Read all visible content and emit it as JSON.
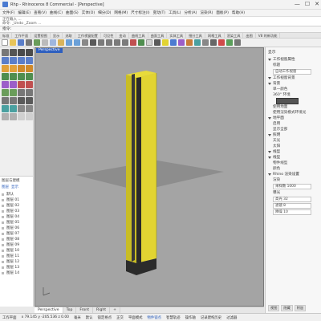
{
  "window": {
    "title": "Rhp - Rhinoceros 8 Commercial - [Perspective]",
    "controls": [
      "—",
      "☐",
      "✕"
    ]
  },
  "menu": [
    "文件(F)",
    "编辑(E)",
    "查看(V)",
    "曲线(C)",
    "曲面(S)",
    "实体(O)",
    "细分(D)",
    "网格(M)",
    "尺寸标注(I)",
    "变动(T)",
    "工具(L)",
    "分析(A)",
    "渲染(R)",
    "面板(P)",
    "帮助(H)"
  ],
  "command_history": [
    "正在载入 ...",
    "命令: _Undo  _Zoom ...",
    "指令: _Zoom All Extents"
  ],
  "command_prompt": "指令:",
  "toolbar_tabs": [
    "标准",
    "工作平面",
    "设置视图",
    "显示",
    "选取",
    "工作视窗配置",
    "可见性",
    "变动",
    "曲线工具",
    "曲面工具",
    "实体工具",
    "细分工具",
    "网格工具",
    "渲染工具",
    "出图",
    "V8 的新功能"
  ],
  "viewport": {
    "label": "Perspective"
  },
  "layers_panel": {
    "header": "图层与建模",
    "tabs": [
      "图层",
      "显示"
    ],
    "items": [
      "默认",
      "图层 01",
      "图层 02",
      "图层 03",
      "图层 04",
      "图层 05",
      "图层 06",
      "图层 07",
      "图层 08",
      "图层 09",
      "图层 10",
      "图层 11",
      "图层 12",
      "图层 13",
      "图层 14"
    ]
  },
  "view_tabs": [
    "Perspective",
    "Top",
    "Front",
    "Right",
    "+"
  ],
  "status": {
    "cplane": "工作平面",
    "coords": "x 79.145   y -205.536   z 0.00",
    "units": "毫米",
    "layer": "默认",
    "items": [
      "锁定格点",
      "正交",
      "平面模式",
      "物件锁点",
      "智慧轨迹",
      "操作轴",
      "记录建构历史",
      "过滤器"
    ]
  },
  "right_panel": {
    "title": "显示",
    "sections": [
      {
        "label": "工作视窗属性",
        "rows": [
          "标题",
          "自动工作视窗"
        ]
      },
      {
        "label": "工作视窗背景",
        "rows": []
      },
      {
        "label": "背景",
        "rows": [
          "单一颜色",
          "360° 环境",
          "使用地面",
          "使用渲染模式环境光"
        ]
      },
      {
        "label": "地平面",
        "rows": [
          "启用",
          "显示全部"
        ]
      },
      {
        "label": "照明",
        "rows": [
          "天光",
          "太阳"
        ]
      },
      {
        "label": "线型",
        "rows": []
      },
      {
        "label": "线型",
        "rows": [
          "物件线型",
          "颜色"
        ]
      },
      {
        "label": "Rhino 渲染设置",
        "rows": [
          "渲染",
          "采样数 1000",
          "曝光",
          "高光 32",
          "滤镜 8",
          "降噪 10"
        ]
      }
    ],
    "bottom": [
      "视图",
      "隐藏",
      "附加"
    ]
  },
  "colors": {
    "viewport_bg": "#a4a4a4",
    "accent": "#2e5fbf",
    "yellow": "#e2d432",
    "dark": "#2a2a2a"
  }
}
